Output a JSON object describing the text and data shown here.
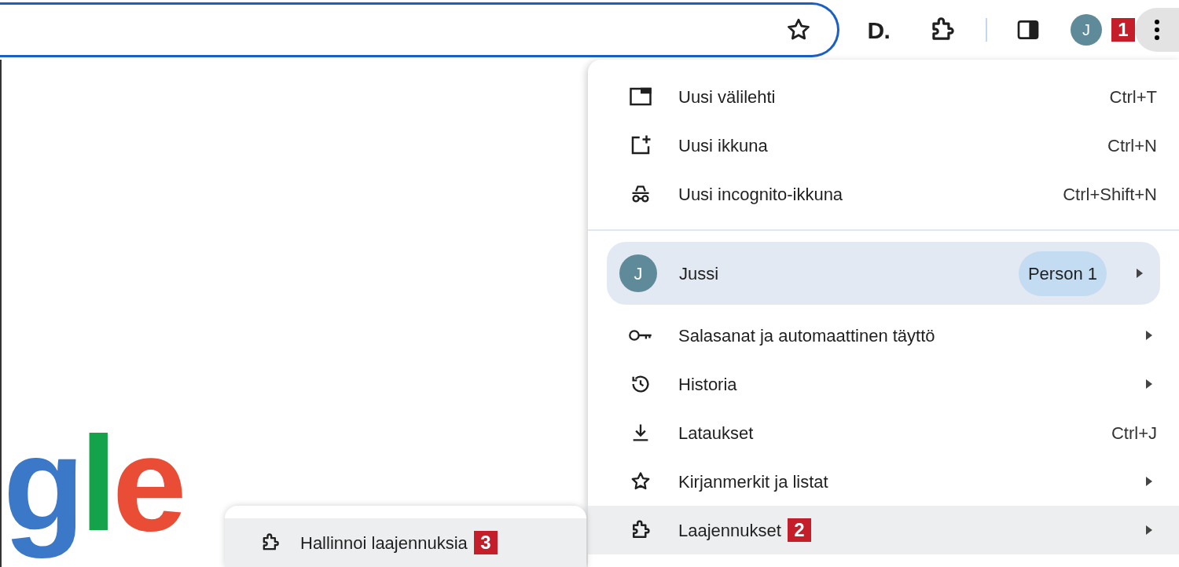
{
  "toolbar": {
    "extension_letter": "D.",
    "avatar_letter": "J",
    "badge": "1",
    "menu_button_pressed": true
  },
  "logo": [
    {
      "letter": "g",
      "color": "#3b78c7"
    },
    {
      "letter": "l",
      "color": "#14a24a"
    },
    {
      "letter": "e",
      "color": "#ea4d35"
    }
  ],
  "menu": {
    "items": [
      {
        "kind": "item",
        "label": "Uusi välilehti",
        "shortcut": "Ctrl+T",
        "submenu": false,
        "highlighted": false
      },
      {
        "kind": "item",
        "label": "Uusi ikkuna",
        "shortcut": "Ctrl+N",
        "submenu": false,
        "highlighted": false
      },
      {
        "kind": "item",
        "label": "Uusi incognito-ikkuna",
        "shortcut": "Ctrl+Shift+N",
        "submenu": false,
        "highlighted": false
      },
      {
        "kind": "separator"
      },
      {
        "kind": "profile",
        "label": "Jussi",
        "avatar_letter": "J",
        "tag": "Person 1",
        "submenu": true,
        "highlighted": true
      },
      {
        "kind": "item",
        "label": "Salasanat ja automaattinen täyttö",
        "submenu": true,
        "highlighted": false
      },
      {
        "kind": "item",
        "label": "Historia",
        "submenu": true,
        "highlighted": false
      },
      {
        "kind": "item",
        "label": "Lataukset",
        "shortcut": "Ctrl+J",
        "submenu": false,
        "highlighted": false
      },
      {
        "kind": "item",
        "label": "Kirjanmerkit ja listat",
        "submenu": true,
        "highlighted": false
      },
      {
        "kind": "item",
        "label": "Laajennukset",
        "badge": "2",
        "submenu": true,
        "highlighted": true
      }
    ]
  },
  "submenu": {
    "items": [
      {
        "label": "Hallinnoi laajennuksia",
        "badge": "3",
        "highlighted": true
      }
    ]
  }
}
